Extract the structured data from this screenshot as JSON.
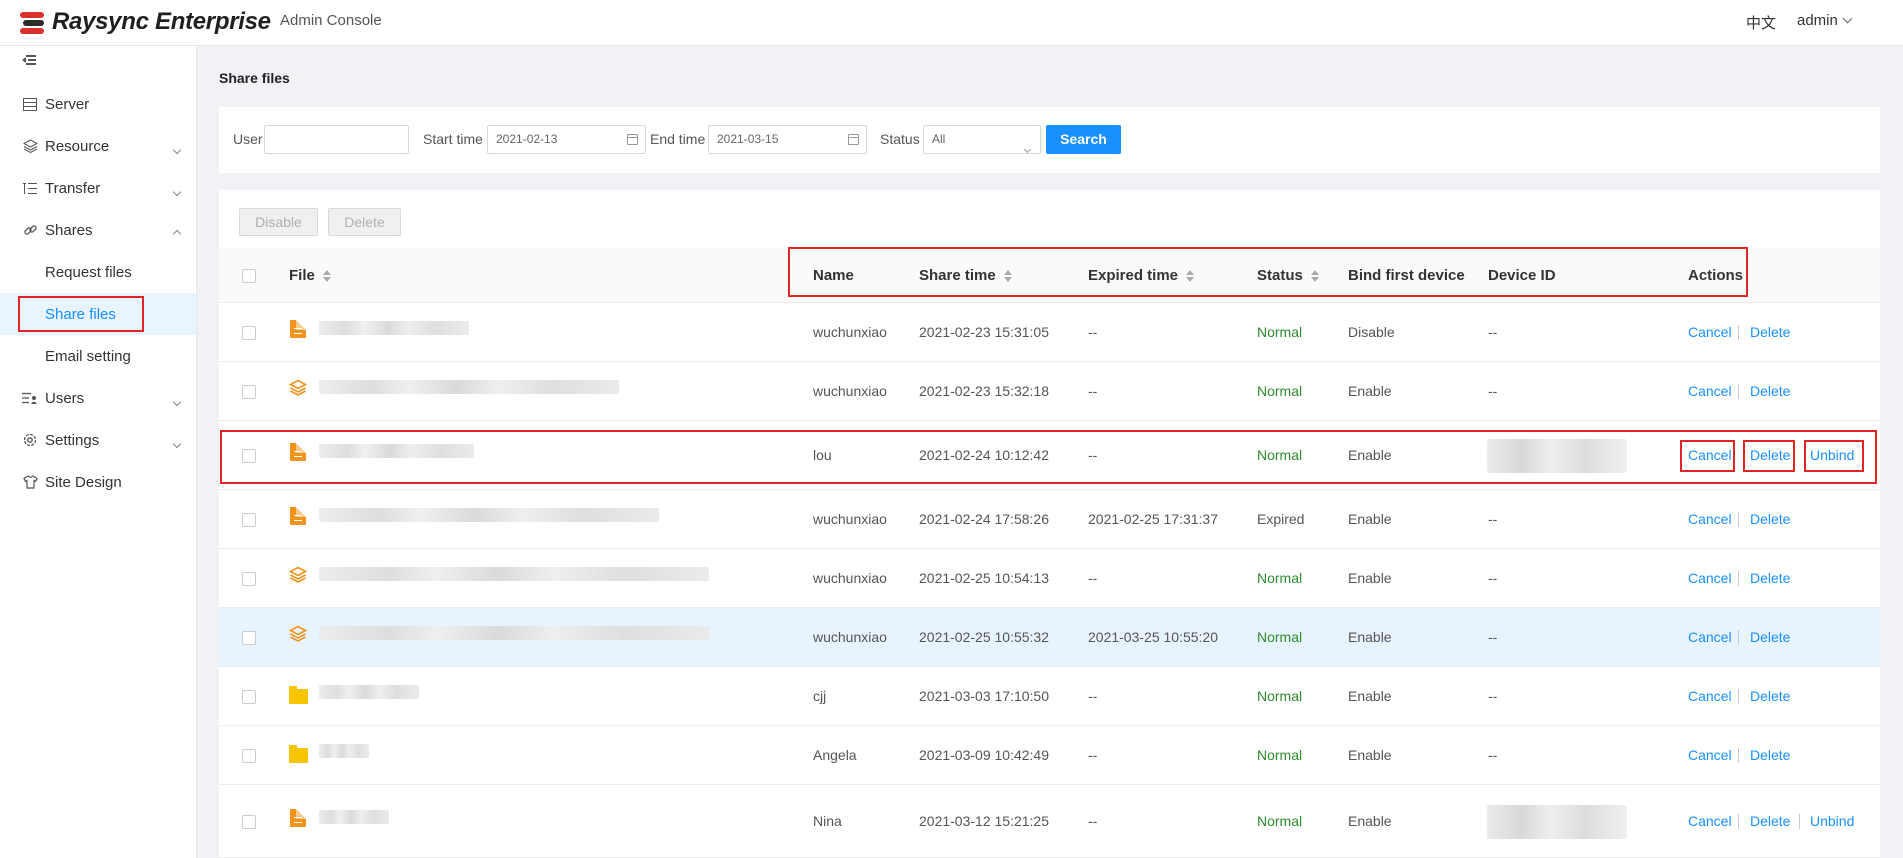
{
  "header": {
    "brand": "Raysync Enterprise",
    "console_title": "Admin Console",
    "language": "中文",
    "user": "admin"
  },
  "sidebar": {
    "items": [
      {
        "label": "Server",
        "icon": "server-icon"
      },
      {
        "label": "Resource",
        "icon": "layers-icon",
        "expandable": true
      },
      {
        "label": "Transfer",
        "icon": "list-icon",
        "expandable": true
      },
      {
        "label": "Shares",
        "icon": "link-icon",
        "expandable": true,
        "expanded": true
      },
      {
        "label": "Users",
        "icon": "users-icon",
        "expandable": true
      },
      {
        "label": "Settings",
        "icon": "gear-icon",
        "expandable": true
      },
      {
        "label": "Site Design",
        "icon": "shirt-icon"
      }
    ],
    "shares_sub": [
      "Request files",
      "Share files",
      "Email setting"
    ],
    "active_sub": "Share files"
  },
  "page": {
    "title": "Share files"
  },
  "filters": {
    "user_label": "User",
    "user_value": "",
    "start_label": "Start time",
    "start_value": "2021-02-13",
    "end_label": "End time",
    "end_value": "2021-03-15",
    "status_label": "Status",
    "status_value": "All",
    "search_label": "Search"
  },
  "toolbar": {
    "disable_label": "Disable",
    "delete_label": "Delete"
  },
  "table": {
    "columns": {
      "file": "File",
      "name": "Name",
      "share_time": "Share time",
      "expired_time": "Expired time",
      "status": "Status",
      "bind_first_device": "Bind first device",
      "device_id": "Device ID",
      "actions": "Actions"
    },
    "action_labels": {
      "cancel": "Cancel",
      "delete": "Delete",
      "unbind": "Unbind"
    },
    "rows": [
      {
        "type": "doc",
        "name": "wuchunxiao",
        "share_time": "2021-02-23 15:31:05",
        "expired_time": "--",
        "status": "Normal",
        "bind": "Disable",
        "device_id": "--",
        "unbind": false
      },
      {
        "type": "layers",
        "name": "wuchunxiao",
        "share_time": "2021-02-23 15:32:18",
        "expired_time": "--",
        "status": "Normal",
        "bind": "Enable",
        "device_id": "--",
        "unbind": false
      },
      {
        "type": "doc",
        "name": "lou",
        "share_time": "2021-02-24 10:12:42",
        "expired_time": "--",
        "status": "Normal",
        "bind": "Enable",
        "device_id": "",
        "unbind": true
      },
      {
        "type": "doc",
        "name": "wuchunxiao",
        "share_time": "2021-02-24 17:58:26",
        "expired_time": "2021-02-25 17:31:37",
        "status": "Expired",
        "bind": "Enable",
        "device_id": "--",
        "unbind": false
      },
      {
        "type": "layers",
        "name": "wuchunxiao",
        "share_time": "2021-02-25 10:54:13",
        "expired_time": "--",
        "status": "Normal",
        "bind": "Enable",
        "device_id": "--",
        "unbind": false
      },
      {
        "type": "layers",
        "name": "wuchunxiao",
        "share_time": "2021-02-25 10:55:32",
        "expired_time": "2021-03-25 10:55:20",
        "status": "Normal",
        "bind": "Enable",
        "device_id": "--",
        "unbind": false
      },
      {
        "type": "folder",
        "name": "cjj",
        "share_time": "2021-03-03 17:10:50",
        "expired_time": "--",
        "status": "Normal",
        "bind": "Enable",
        "device_id": "--",
        "unbind": false
      },
      {
        "type": "folder",
        "name": "Angela",
        "share_time": "2021-03-09 10:42:49",
        "expired_time": "--",
        "status": "Normal",
        "bind": "Enable",
        "device_id": "--",
        "unbind": false
      },
      {
        "type": "doc",
        "name": "Nina",
        "share_time": "2021-03-12 15:21:25",
        "expired_time": "--",
        "status": "Normal",
        "bind": "Enable",
        "device_id": "",
        "unbind": true
      }
    ]
  },
  "colors": {
    "accent": "#1890ff",
    "status_normal": "#2e8b2e",
    "annotation_red": "#e02424",
    "doc_orange": "#f0941e",
    "folder_yellow": "#f6c500"
  }
}
